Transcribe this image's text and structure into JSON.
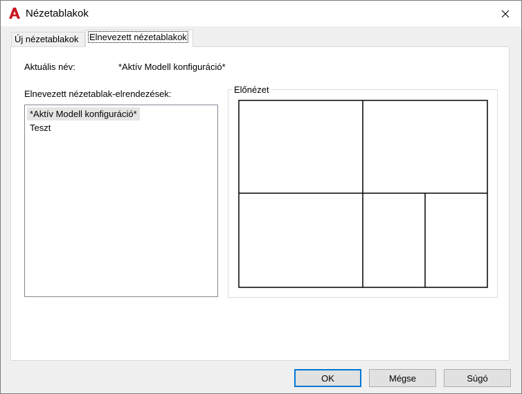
{
  "window": {
    "title": "Nézetablakok",
    "close_icon": "close-icon",
    "app_icon": "autocad-a-icon",
    "accent_color": "#c8171f"
  },
  "tabs": [
    {
      "label": "Új nézetablakok",
      "active": false
    },
    {
      "label": "Elnevezett nézetablakok",
      "active": true
    }
  ],
  "named": {
    "current_name_label": "Aktuális név:",
    "current_name_value": "*Aktív Modell konfiguráció*",
    "list_label": "Elnevezett nézetablak-elrendezések:",
    "list_items": [
      {
        "label": "*Aktív Modell konfiguráció*",
        "selected": true
      },
      {
        "label": "Teszt",
        "selected": false
      }
    ],
    "preview_label": "Előnézet"
  },
  "buttons": {
    "ok": "OK",
    "cancel": "Mégse",
    "help": "Súgó"
  }
}
